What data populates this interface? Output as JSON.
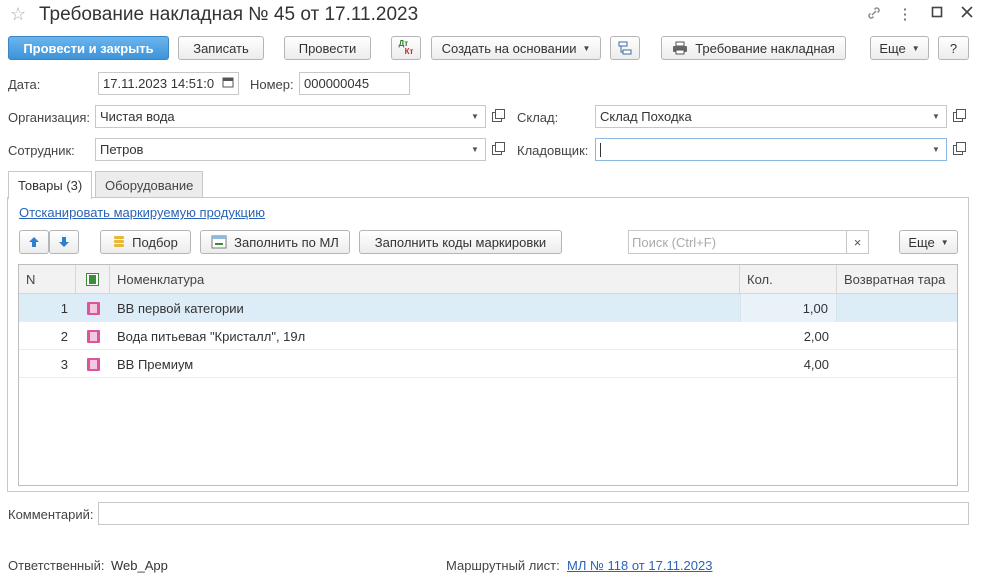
{
  "window": {
    "title": "Требование накладная № 45 от 17.11.2023",
    "controls": [
      "link-icon",
      "more-vertical-icon",
      "maximize-icon",
      "close-icon"
    ]
  },
  "toolbar": {
    "post_close": "Провести и закрыть",
    "save": "Записать",
    "post": "Провести",
    "dtkt_top": "Дт",
    "dtkt_bottom": "Кт",
    "create_based": "Создать на основании",
    "print_form": "Требование накладная",
    "more": "Еще",
    "help": "?"
  },
  "header": {
    "date_label": "Дата:",
    "date_value": "17.11.2023 14:51:0",
    "number_label": "Номер:",
    "number_value": "000000045",
    "org_label": "Организация:",
    "org_value": "Чистая вода",
    "warehouse_label": "Склад:",
    "warehouse_value": "Склад Походка",
    "employee_label": "Сотрудник:",
    "employee_value": "Петров",
    "storekeeper_label": "Кладовщик:",
    "storekeeper_value": ""
  },
  "tabs": [
    {
      "label": "Товары (3)",
      "active": true
    },
    {
      "label": "Оборудование",
      "active": false
    }
  ],
  "goods": {
    "scan_link": "Отсканировать маркируемую продукцию",
    "pick_button": "Подбор",
    "fill_ml_button": "Заполнить по МЛ",
    "fill_codes_button": "Заполнить коды маркировки",
    "search_placeholder": "Поиск (Ctrl+F)",
    "more": "Еще",
    "columns": {
      "n": "N",
      "nomenclature": "Номенклатура",
      "qty": "Кол.",
      "return": "Возвратная тара"
    },
    "rows": [
      {
        "n": "1",
        "name": "ВВ первой категории",
        "qty": "1,00",
        "ret": ""
      },
      {
        "n": "2",
        "name": "Вода питьевая \"Кристалл\", 19л",
        "qty": "2,00",
        "ret": ""
      },
      {
        "n": "3",
        "name": "ВВ Премиум",
        "qty": "4,00",
        "ret": ""
      }
    ]
  },
  "footer": {
    "comment_label": "Комментарий:",
    "comment_value": "",
    "responsible_label": "Ответственный:",
    "responsible_value": "Web_App",
    "route_label": "Маршрутный лист:",
    "route_value": "МЛ № 118 от 17.11.2023"
  },
  "colors": {
    "primary": "#3d93d9",
    "link": "#2a64b6",
    "selected_row": "#dcedf8"
  }
}
